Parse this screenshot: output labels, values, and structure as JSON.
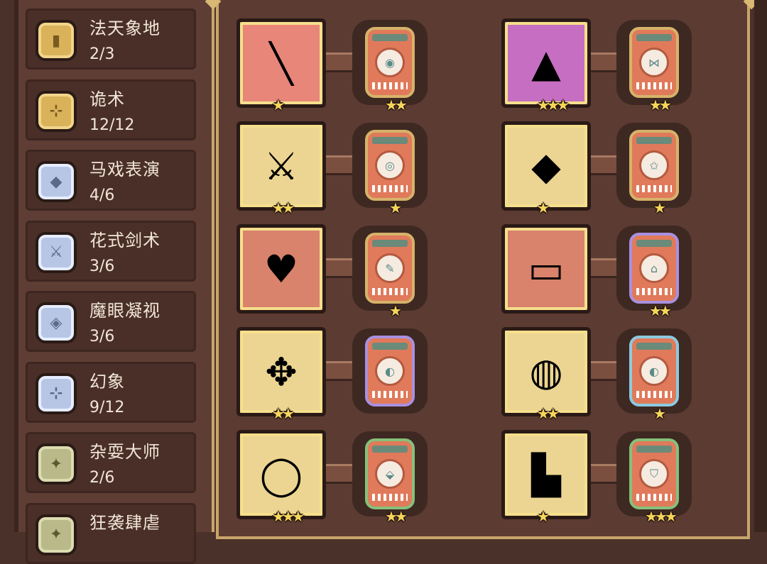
{
  "traits": [
    {
      "name": "法天象地",
      "count": "2/3",
      "badge": "gold",
      "glyph": "▮",
      "icon": "pillar-icon"
    },
    {
      "name": "诡术",
      "count": "12/12",
      "badge": "gold",
      "glyph": "⊹",
      "icon": "cross-icon"
    },
    {
      "name": "马戏表演",
      "count": "4/6",
      "badge": "silver",
      "glyph": "◆",
      "icon": "pick-icon"
    },
    {
      "name": "花式剑术",
      "count": "3/6",
      "badge": "silver",
      "glyph": "⚔",
      "icon": "blades-icon"
    },
    {
      "name": "魔眼凝视",
      "count": "3/6",
      "badge": "silver",
      "glyph": "◈",
      "icon": "eye-icon"
    },
    {
      "name": "幻象",
      "count": "9/12",
      "badge": "silver",
      "glyph": "⊹",
      "icon": "cross-icon"
    },
    {
      "name": "杂耍大师",
      "count": "2/6",
      "badge": "green",
      "glyph": "✦",
      "icon": "juggle-icon"
    },
    {
      "name": "狂袭肆虐",
      "count": "",
      "badge": "green",
      "glyph": "✦",
      "icon": "rampage-icon"
    }
  ],
  "equipment": [
    {
      "item_icon": "staff-icon",
      "glyph": "╲",
      "bg": "pink",
      "item_stars": "★",
      "rune_frame": "gold",
      "rune_glyph": "◉",
      "rune_stars": "★★"
    },
    {
      "item_icon": "green-hood-icon",
      "glyph": "▲",
      "bg": "purple",
      "item_stars": "★★★",
      "rune_frame": "gold",
      "rune_glyph": "⋈",
      "rune_stars": "★★"
    },
    {
      "item_icon": "crossed-swords-icon",
      "glyph": "⚔",
      "bg": "gold",
      "item_stars": "★★",
      "rune_frame": "gold",
      "rune_glyph": "◎",
      "rune_stars": "★"
    },
    {
      "item_icon": "jade-armor-icon",
      "glyph": "◆",
      "bg": "gold",
      "item_stars": "★",
      "rune_frame": "gold",
      "rune_glyph": "✩",
      "rune_stars": "★"
    },
    {
      "item_icon": "heart-amulet-icon",
      "glyph": "♥",
      "bg": "salmon",
      "item_stars": "",
      "rune_frame": "gold",
      "rune_glyph": "✎",
      "rune_stars": "★"
    },
    {
      "item_icon": "scroll-icon",
      "glyph": "▭",
      "bg": "salmon",
      "item_stars": "",
      "rune_frame": "purple",
      "rune_glyph": "⌂",
      "rune_stars": "★★"
    },
    {
      "item_icon": "jeweled-cross-icon",
      "glyph": "✥",
      "bg": "gold",
      "item_stars": "★★",
      "rune_frame": "purple",
      "rune_glyph": "◐",
      "rune_stars": ""
    },
    {
      "item_icon": "bracelet-icon",
      "glyph": "◍",
      "bg": "gold",
      "item_stars": "★★",
      "rune_frame": "blue",
      "rune_glyph": "◐",
      "rune_stars": "★"
    },
    {
      "item_icon": "ruby-ring-icon",
      "glyph": "◯",
      "bg": "gold",
      "item_stars": "★★★",
      "rune_frame": "green",
      "rune_glyph": "⬙",
      "rune_stars": "★★"
    },
    {
      "item_icon": "boots-icon",
      "glyph": "▙",
      "bg": "gold",
      "item_stars": "★",
      "rune_frame": "green",
      "rune_glyph": "⛉",
      "rune_stars": "★★★"
    }
  ]
}
